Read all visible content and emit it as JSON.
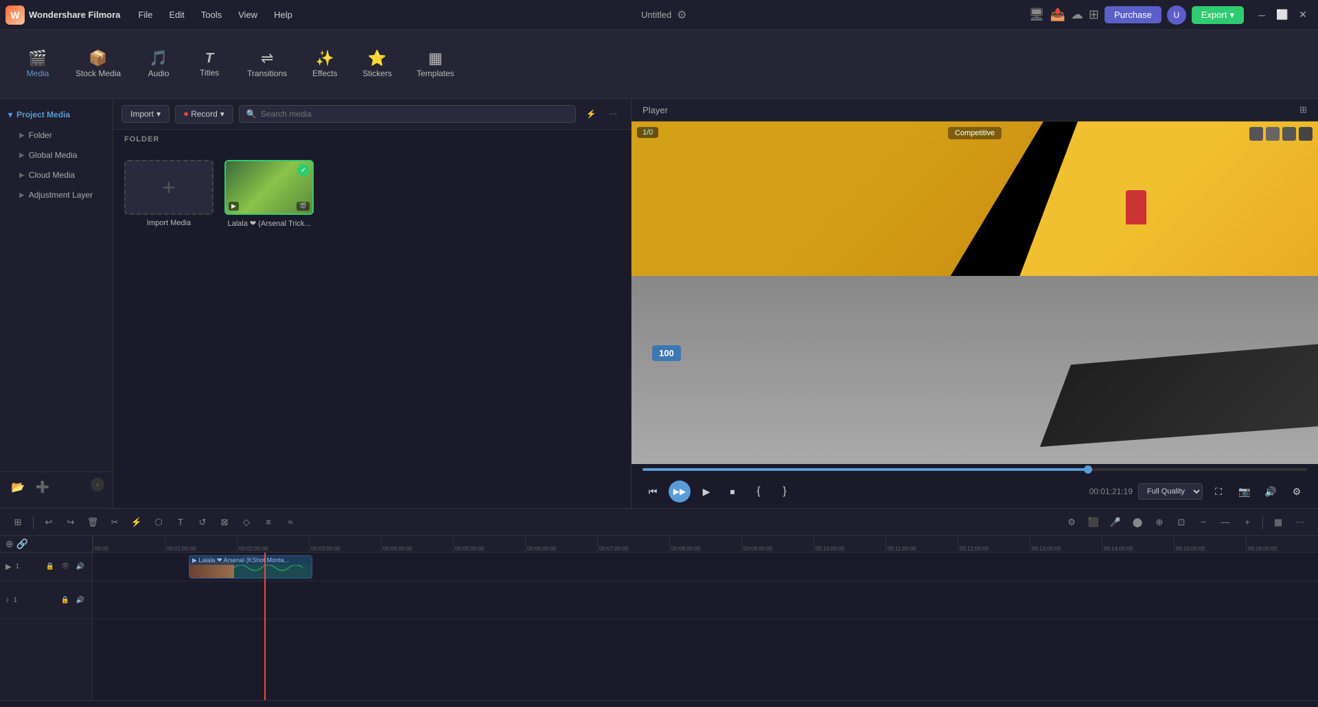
{
  "app": {
    "name": "Wondershare Filmora",
    "title": "Untitled",
    "logo_letter": "W"
  },
  "titlebar": {
    "menu": [
      "File",
      "Edit",
      "Tools",
      "View",
      "Help"
    ],
    "purchase_label": "Purchase",
    "export_label": "Export",
    "avatar_letter": "U"
  },
  "toolbar": {
    "items": [
      {
        "id": "media",
        "label": "Media",
        "icon": "🎬"
      },
      {
        "id": "stock-media",
        "label": "Stock Media",
        "icon": "📦"
      },
      {
        "id": "audio",
        "label": "Audio",
        "icon": "🎵"
      },
      {
        "id": "titles",
        "label": "Titles",
        "icon": "T"
      },
      {
        "id": "transitions",
        "label": "Transitions",
        "icon": "↔"
      },
      {
        "id": "effects",
        "label": "Effects",
        "icon": "✨"
      },
      {
        "id": "stickers",
        "label": "Stickers",
        "icon": "🌟"
      },
      {
        "id": "templates",
        "label": "Templates",
        "icon": "⊞"
      }
    ],
    "active": "media"
  },
  "sidebar": {
    "header": "Project Media",
    "items": [
      {
        "id": "folder",
        "label": "Folder"
      },
      {
        "id": "global-media",
        "label": "Global Media"
      },
      {
        "id": "cloud-media",
        "label": "Cloud Media"
      },
      {
        "id": "adjustment-layer",
        "label": "Adjustment Layer"
      }
    ]
  },
  "media": {
    "import_label": "Import",
    "record_label": "Record",
    "search_placeholder": "Search media",
    "folder_label": "FOLDER",
    "cards": [
      {
        "id": "import",
        "type": "import",
        "label": "Import Media",
        "icon": "+"
      },
      {
        "id": "video1",
        "type": "video",
        "label": "Lalala ❤ (Arsenal Trick...",
        "selected": true
      }
    ]
  },
  "player": {
    "title": "Player",
    "timestamp": "00:01:21:19",
    "quality": "Full Quality",
    "scrubber_pct": 67
  },
  "timeline": {
    "toolbar_tools": [
      "⊞",
      "↩",
      "↪",
      "🗑",
      "✂",
      "⚡",
      "⬡",
      "↕",
      "⊕",
      "↺",
      "⊠",
      "◇",
      "⊜",
      "≡",
      "≈"
    ],
    "ruler_marks": [
      "00:00",
      "00:01:00:00",
      "00:02:00:00",
      "00:03:00:00",
      "00:04:00:00",
      "00:05:00:00",
      "00:06:00:00",
      "00:07:00:00",
      "00:08:00:00",
      "00:09:00:00",
      "00:10:00:00",
      "00:11:00:00",
      "00:12:00:00",
      "00:13:00:00",
      "00:14:00:00",
      "00:15:00:00",
      "00:16:00:00"
    ],
    "tracks": [
      {
        "id": "video1",
        "type": "video",
        "number": 1,
        "clip_label": "Lalala ❤ Arsenal (KShot Monta..."
      },
      {
        "id": "audio1",
        "type": "audio",
        "number": 1
      }
    ]
  }
}
